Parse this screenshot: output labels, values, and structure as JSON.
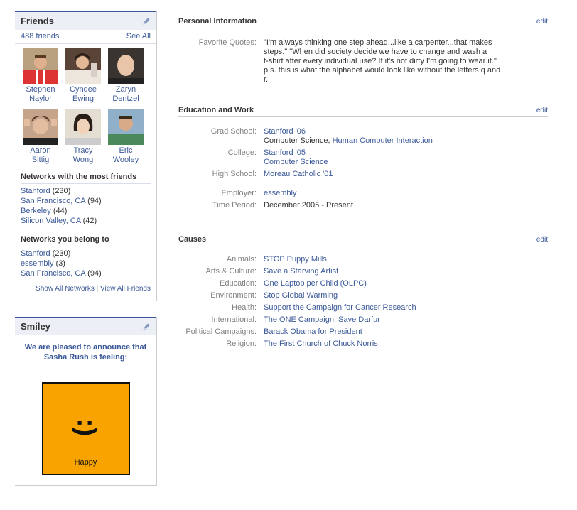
{
  "friends": {
    "title": "Friends",
    "count": "488 friends.",
    "see_all": "See All",
    "people": [
      {
        "first": "Stephen",
        "last": "Naylor"
      },
      {
        "first": "Cyndee",
        "last": "Ewing"
      },
      {
        "first": "Zaryn",
        "last": "Dentzel"
      },
      {
        "first": "Aaron",
        "last": "Sittig"
      },
      {
        "first": "Tracy",
        "last": "Wong"
      },
      {
        "first": "Eric",
        "last": "Wooley"
      }
    ],
    "most_friends_head": "Networks with the most friends",
    "most_friends": [
      {
        "name": "Stanford",
        "count": "(230)"
      },
      {
        "name": "San Francisco, CA",
        "count": "(94)"
      },
      {
        "name": "Berkeley",
        "count": "(44)"
      },
      {
        "name": "Silicon Valley, CA",
        "count": "(42)"
      }
    ],
    "belong_head": "Networks you belong to",
    "belong": [
      {
        "name": "Stanford",
        "count": "(230)"
      },
      {
        "name": "essembly",
        "count": "(3)"
      },
      {
        "name": "San Francisco, CA",
        "count": "(94)"
      }
    ],
    "show_all_networks": "Show All Networks",
    "separator": "|",
    "view_all_friends": "View All Friends"
  },
  "smiley": {
    "title": "Smiley",
    "message": "We are pleased to announce that Sasha Rush is feeling:",
    "face": ":)",
    "mood": "Happy"
  },
  "personal": {
    "title": "Personal Information",
    "edit": "edit",
    "quotes_label": "Favorite Quotes:",
    "quotes_lines": [
      "\"I'm always thinking one step ahead...like a carpenter...that makes",
      "steps.\" \"When did society decide we have to change and wash a",
      "t-shirt after every individual use? If it's not dirty I'm going to wear it.\"",
      "p.s. this is what the alphabet would look like without the letters q and",
      "r."
    ]
  },
  "education": {
    "title": "Education and Work",
    "edit": "edit",
    "grad_label": "Grad School:",
    "grad_school": "Stanford '06",
    "grad_major": "Computer Science,",
    "grad_major2": "Human Computer Interaction",
    "college_label": "College:",
    "college": "Stanford '05",
    "college_major": "Computer Science",
    "hs_label": "High School:",
    "high_school": "Moreau Catholic '01",
    "employer_label": "Employer:",
    "employer": "essembly",
    "period_label": "Time Period:",
    "period": "December 2005 - Present"
  },
  "causes": {
    "title": "Causes",
    "edit": "edit",
    "items": [
      {
        "label": "Animals:",
        "value": "STOP Puppy Mills"
      },
      {
        "label": "Arts & Culture:",
        "value": "Save a Starving Artist"
      },
      {
        "label": "Education:",
        "value": "One Laptop per Child (OLPC)"
      },
      {
        "label": "Environment:",
        "value": "Stop Global Warming"
      },
      {
        "label": "Health:",
        "value": "Support the Campaign for Cancer Research"
      },
      {
        "label": "International:",
        "value": "The ONE Campaign, Save Darfur"
      },
      {
        "label": "Political Campaigns:",
        "value": "Barack Obama for President"
      },
      {
        "label": "Religion:",
        "value": "The First Church of Chuck Norris"
      }
    ]
  },
  "colors": {
    "link": "#3b5998",
    "header_bg": "#eceff5",
    "smiley_bg": "#f9a300"
  }
}
